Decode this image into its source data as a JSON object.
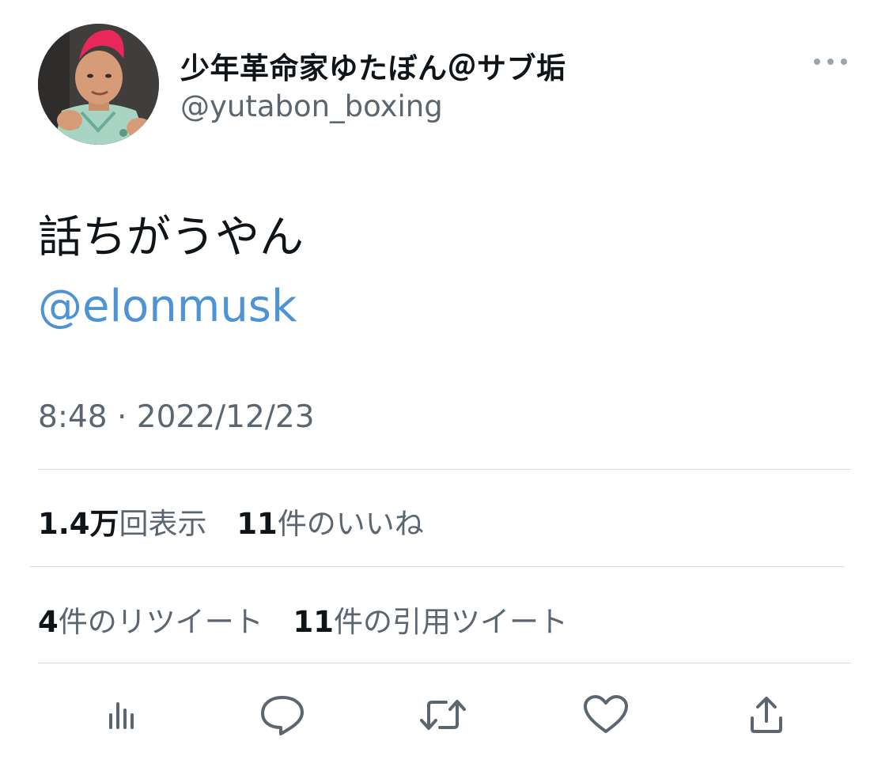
{
  "author": {
    "display_name": "少年革命家ゆたぼん＠サブ垢",
    "handle": "@yutabon_boxing"
  },
  "tweet": {
    "text": "話ちがうやん",
    "mention": "@elonmusk",
    "timestamp": "8:48 · 2022/12/23"
  },
  "stats": {
    "views_count": "1.4万",
    "views_label": "回表示",
    "likes_count": "11",
    "likes_label": "件のいいね",
    "retweets_count": "4",
    "retweets_label": "件のリツイート",
    "quotes_count": "11",
    "quotes_label": "件の引用ツイート"
  },
  "actions": {
    "icons": [
      "analytics-icon",
      "reply-icon",
      "retweet-icon",
      "like-icon",
      "share-icon"
    ]
  },
  "colors": {
    "link": "#4e94d4",
    "text": "#0f1419",
    "secondary": "#5b6670",
    "divider": "#d7dce0",
    "hair": "#e8275b"
  }
}
